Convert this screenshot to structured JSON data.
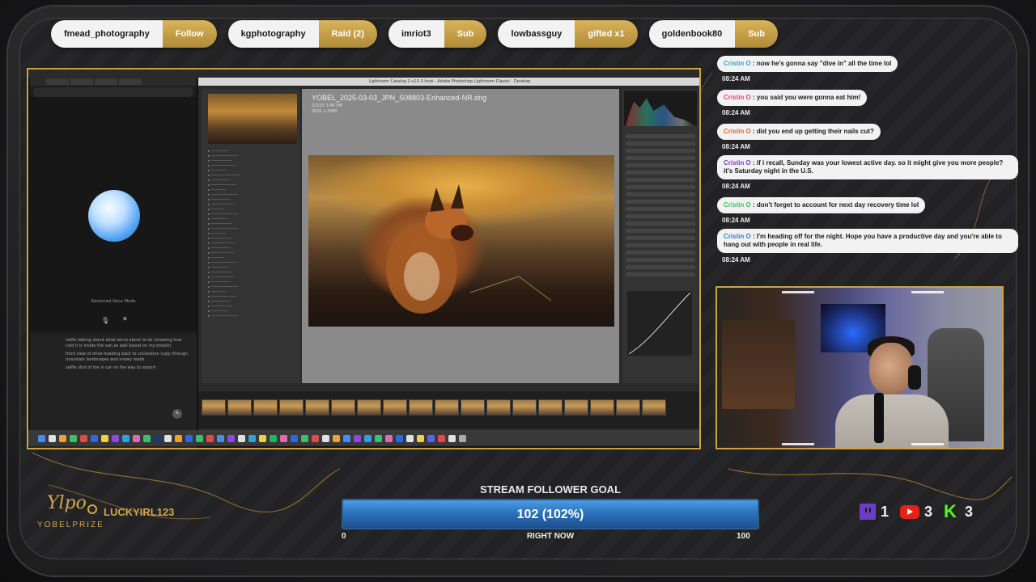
{
  "alerts": [
    {
      "name": "fmead_photography",
      "action": "Follow"
    },
    {
      "name": "kgphotography",
      "action": "Raid (2)"
    },
    {
      "name": "imriot3",
      "action": "Sub"
    },
    {
      "name": "lowbassguy",
      "action": "gifted x1"
    },
    {
      "name": "goldenbook80",
      "action": "Sub"
    }
  ],
  "screen": {
    "lightroom_title": "Lightroom Catalog-2-v13-3.lrcat - Adobe Photoshop Lightroom Classic - Develop",
    "photo_filename": "YOBEL_2025-03-03_JPN_S08803-Enhanced-NR.dng",
    "photo_meta": [
      "3/3/25 3:46 PM",
      "3620 x 2080"
    ],
    "voice_label": "Advanced Voice Mode",
    "notes": [
      "selfie talking about what we're about to do (showing how cold it is inside the van as well based on my breath)",
      "front view of drive heading back to civilization (ugly through mountain landscapes and snowy roads",
      "selfie shot of me in car on the way to airport"
    ]
  },
  "chat": [
    {
      "user": "Cristin O",
      "message": "now he's gonna say \"dive in\" all the time lol",
      "time": "08:24 AM"
    },
    {
      "user": "Cristin O",
      "message": "you said you were gonna eat him!",
      "time": "08:24 AM"
    },
    {
      "user": "Cristin O",
      "message": "did you end up getting their nails cut?",
      "time": "08:24 AM"
    },
    {
      "user": "Cristin O",
      "message": "if i recall, Sunday was your lowest active day. so it might give you more people? it's Saturday night in the U.S.",
      "time": "08:24 AM"
    },
    {
      "user": "Cristin O",
      "message": "don't forget to account for next day recovery time lol",
      "time": "08:24 AM"
    },
    {
      "user": "Cristin O",
      "message": "I'm heading off for the night. Hope you have a productive day and you're able to hang out with people in real life.",
      "time": "08:24 AM"
    }
  ],
  "user_colors": [
    "#2ea8c9",
    "#e0457b",
    "#e06a2a",
    "#7a3cc8",
    "#2ec95a",
    "#2e7fd9"
  ],
  "branding": {
    "signature": "Ylpo",
    "name": "YOBELPRIZE",
    "latest_follower": "LUCKYIRL123"
  },
  "goal": {
    "title": "STREAM FOLLOWER GOAL",
    "value_text": "102 (102%)",
    "progress": 1.0,
    "min": "0",
    "label": "RIGHT NOW",
    "max": "100"
  },
  "platforms": [
    {
      "name": "twitch-icon",
      "count": "1"
    },
    {
      "name": "youtube-icon",
      "count": "3"
    },
    {
      "name": "kick-icon",
      "count": "3"
    }
  ]
}
